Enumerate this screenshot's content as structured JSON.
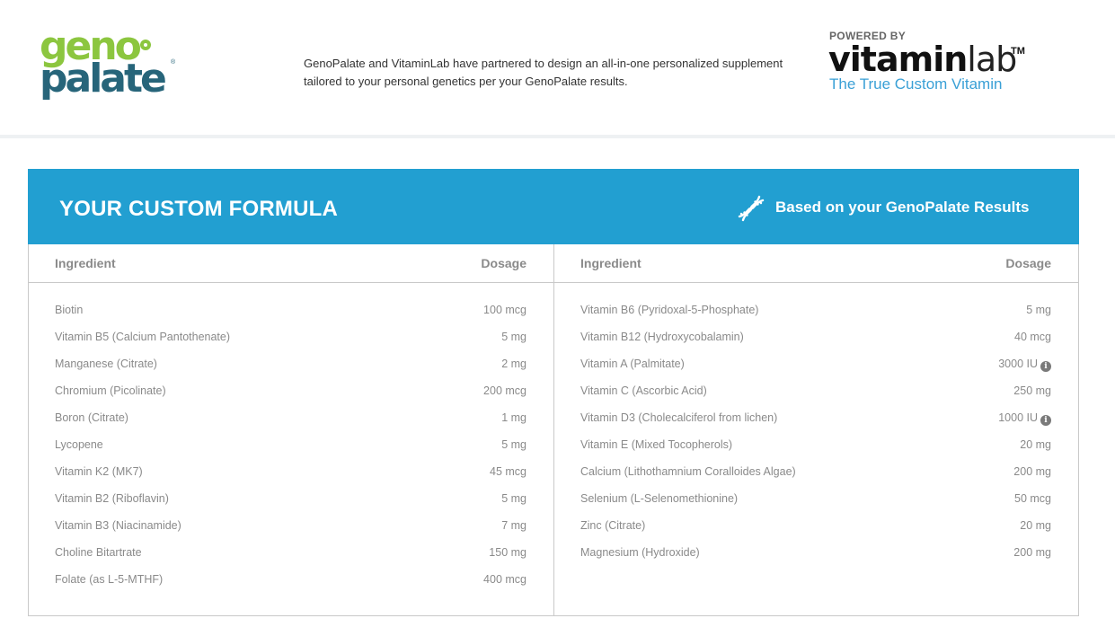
{
  "header": {
    "geno_logo": {
      "line1": "geno",
      "line2": "palate",
      "registered": "®"
    },
    "partner_text": "GenoPalate and VitaminLab have partnered to design an all-in-one personalized supplement tailored to your personal genetics per your GenoPalate results.",
    "vitaminlab": {
      "powered_by": "POWERED BY",
      "word_bold": "vitamin",
      "word_light": "lab",
      "tm": "TM",
      "tagline": "The True Custom Vitamin"
    }
  },
  "formula": {
    "title": "YOUR CUSTOM FORMULA",
    "based_on": "Based on your GenoPalate Results",
    "icon": "dna-icon",
    "colors": {
      "banner": "#229fd1",
      "geno_green": "#8cc63f",
      "geno_teal": "#27657a",
      "vitaminlab_blue": "#3aa0d6"
    },
    "left": {
      "ingredient_header": "Ingredient",
      "dosage_header": "Dosage",
      "rows": [
        {
          "name": "Biotin",
          "dose": "100 mcg"
        },
        {
          "name": "Vitamin B5 (Calcium Pantothenate)",
          "dose": "5 mg"
        },
        {
          "name": "Manganese (Citrate)",
          "dose": "2 mg"
        },
        {
          "name": "Chromium (Picolinate)",
          "dose": "200 mcg"
        },
        {
          "name": "Boron (Citrate)",
          "dose": "1 mg"
        },
        {
          "name": "Lycopene",
          "dose": "5 mg"
        },
        {
          "name": "Vitamin K2 (MK7)",
          "dose": "45 mcg"
        },
        {
          "name": "Vitamin B2 (Riboflavin)",
          "dose": "5 mg"
        },
        {
          "name": "Vitamin B3 (Niacinamide)",
          "dose": "7 mg"
        },
        {
          "name": "Choline Bitartrate",
          "dose": "150 mg"
        },
        {
          "name": "Folate (as L-5-MTHF)",
          "dose": "400 mcg"
        }
      ]
    },
    "right": {
      "ingredient_header": "Ingredient",
      "dosage_header": "Dosage",
      "rows": [
        {
          "name": "Vitamin B6 (Pyridoxal-5-Phosphate)",
          "dose": "5 mg"
        },
        {
          "name": "Vitamin B12 (Hydroxycobalamin)",
          "dose": "40 mcg"
        },
        {
          "name": "Vitamin A (Palmitate)",
          "dose": "3000 IU",
          "info": "i"
        },
        {
          "name": "Vitamin C (Ascorbic Acid)",
          "dose": "250 mg"
        },
        {
          "name": "Vitamin D3 (Cholecalciferol from lichen)",
          "dose": "1000 IU",
          "info": "i"
        },
        {
          "name": "Vitamin E (Mixed Tocopherols)",
          "dose": "20 mg"
        },
        {
          "name": "Calcium (Lithothamnium Coralloides Algae)",
          "dose": "200 mg"
        },
        {
          "name": "Selenium (L-Selenomethionine)",
          "dose": "50 mcg"
        },
        {
          "name": "Zinc (Citrate)",
          "dose": "20 mg"
        },
        {
          "name": "Magnesium (Hydroxide)",
          "dose": "200 mg"
        }
      ]
    }
  }
}
